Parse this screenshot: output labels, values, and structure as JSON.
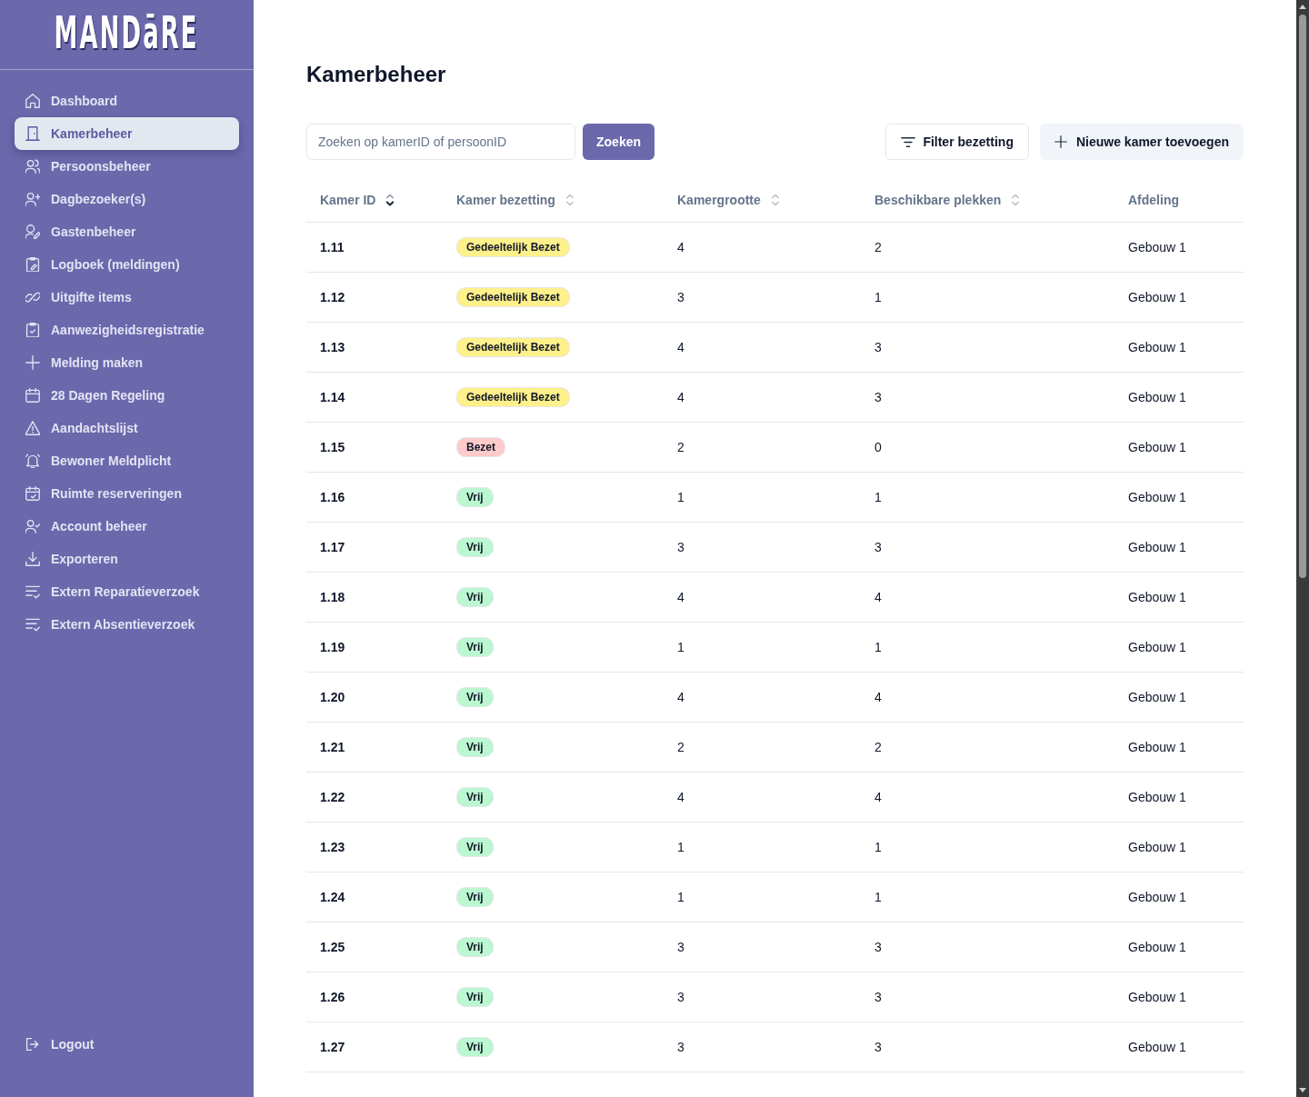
{
  "sidebar": {
    "logo": "MANDāRE",
    "items": [
      {
        "label": "Dashboard",
        "selected": false
      },
      {
        "label": "Kamerbeheer",
        "selected": true
      },
      {
        "label": "Persoonsbeheer",
        "selected": false
      },
      {
        "label": "Dagbezoeker(s)",
        "selected": false
      },
      {
        "label": "Gastenbeheer",
        "selected": false
      },
      {
        "label": "Logboek (meldingen)",
        "selected": false
      },
      {
        "label": "Uitgifte items",
        "selected": false
      },
      {
        "label": "Aanwezigheidsregistratie",
        "selected": false
      },
      {
        "label": "Melding maken",
        "selected": false
      },
      {
        "label": "28 Dagen Regeling",
        "selected": false
      },
      {
        "label": "Aandachtslijst",
        "selected": false
      },
      {
        "label": "Bewoner Meldplicht",
        "selected": false
      },
      {
        "label": "Ruimte reserveringen",
        "selected": false
      },
      {
        "label": "Account beheer",
        "selected": false
      },
      {
        "label": "Exporteren",
        "selected": false
      },
      {
        "label": "Extern Reparatieverzoek",
        "selected": false
      },
      {
        "label": "Extern Absentieverzoek",
        "selected": false
      }
    ],
    "logout": "Logout"
  },
  "page": {
    "title": "Kamerbeheer"
  },
  "toolbar": {
    "search": {
      "placeholder": "Zoeken op kamerID of persoonID"
    },
    "search_button": "Zoeken",
    "filter_button": "Filter bezetting",
    "add_button": "Nieuwe kamer toevoegen"
  },
  "table": {
    "columns": [
      {
        "label": "Kamer ID",
        "sortable": true,
        "sorted": true
      },
      {
        "label": "Kamer bezetting",
        "sortable": true,
        "sorted": false
      },
      {
        "label": "Kamergrootte",
        "sortable": true,
        "sorted": false
      },
      {
        "label": "Beschikbare plekken",
        "sortable": true,
        "sorted": false
      },
      {
        "label": "Afdeling",
        "sortable": false
      }
    ],
    "rows": [
      {
        "kamer_id": "1.11",
        "bezetting": {
          "label": "Gedeeltelijk Bezet",
          "color": "#fef08a"
        },
        "kamergrootte": "4",
        "beschikbare_plekken": "2",
        "afdeling": "Gebouw 1"
      },
      {
        "kamer_id": "1.12",
        "bezetting": {
          "label": "Gedeeltelijk Bezet",
          "color": "#fef08a"
        },
        "kamergrootte": "3",
        "beschikbare_plekken": "1",
        "afdeling": "Gebouw 1"
      },
      {
        "kamer_id": "1.13",
        "bezetting": {
          "label": "Gedeeltelijk Bezet",
          "color": "#fef08a"
        },
        "kamergrootte": "4",
        "beschikbare_plekken": "3",
        "afdeling": "Gebouw 1"
      },
      {
        "kamer_id": "1.14",
        "bezetting": {
          "label": "Gedeeltelijk Bezet",
          "color": "#fef08a"
        },
        "kamergrootte": "4",
        "beschikbare_plekken": "3",
        "afdeling": "Gebouw 1"
      },
      {
        "kamer_id": "1.15",
        "bezetting": {
          "label": "Bezet",
          "color": "#fecaca"
        },
        "kamergrootte": "2",
        "beschikbare_plekken": "0",
        "afdeling": "Gebouw 1"
      },
      {
        "kamer_id": "1.16",
        "bezetting": {
          "label": "Vrij",
          "color": "#bbf7d0"
        },
        "kamergrootte": "1",
        "beschikbare_plekken": "1",
        "afdeling": "Gebouw 1"
      },
      {
        "kamer_id": "1.17",
        "bezetting": {
          "label": "Vrij",
          "color": "#bbf7d0"
        },
        "kamergrootte": "3",
        "beschikbare_plekken": "3",
        "afdeling": "Gebouw 1"
      },
      {
        "kamer_id": "1.18",
        "bezetting": {
          "label": "Vrij",
          "color": "#bbf7d0"
        },
        "kamergrootte": "4",
        "beschikbare_plekken": "4",
        "afdeling": "Gebouw 1"
      },
      {
        "kamer_id": "1.19",
        "bezetting": {
          "label": "Vrij",
          "color": "#bbf7d0"
        },
        "kamergrootte": "1",
        "beschikbare_plekken": "1",
        "afdeling": "Gebouw 1"
      },
      {
        "kamer_id": "1.20",
        "bezetting": {
          "label": "Vrij",
          "color": "#bbf7d0"
        },
        "kamergrootte": "4",
        "beschikbare_plekken": "4",
        "afdeling": "Gebouw 1"
      },
      {
        "kamer_id": "1.21",
        "bezetting": {
          "label": "Vrij",
          "color": "#bbf7d0"
        },
        "kamergrootte": "2",
        "beschikbare_plekken": "2",
        "afdeling": "Gebouw 1"
      },
      {
        "kamer_id": "1.22",
        "bezetting": {
          "label": "Vrij",
          "color": "#bbf7d0"
        },
        "kamergrootte": "4",
        "beschikbare_plekken": "4",
        "afdeling": "Gebouw 1"
      },
      {
        "kamer_id": "1.23",
        "bezetting": {
          "label": "Vrij",
          "color": "#bbf7d0"
        },
        "kamergrootte": "1",
        "beschikbare_plekken": "1",
        "afdeling": "Gebouw 1"
      },
      {
        "kamer_id": "1.24",
        "bezetting": {
          "label": "Vrij",
          "color": "#bbf7d0"
        },
        "kamergrootte": "1",
        "beschikbare_plekken": "1",
        "afdeling": "Gebouw 1"
      },
      {
        "kamer_id": "1.25",
        "bezetting": {
          "label": "Vrij",
          "color": "#bbf7d0"
        },
        "kamergrootte": "3",
        "beschikbare_plekken": "3",
        "afdeling": "Gebouw 1"
      },
      {
        "kamer_id": "1.26",
        "bezetting": {
          "label": "Vrij",
          "color": "#bbf7d0"
        },
        "kamergrootte": "3",
        "beschikbare_plekken": "3",
        "afdeling": "Gebouw 1"
      },
      {
        "kamer_id": "1.27",
        "bezetting": {
          "label": "Vrij",
          "color": "#bbf7d0"
        },
        "kamergrootte": "3",
        "beschikbare_plekken": "3",
        "afdeling": "Gebouw 1"
      }
    ]
  }
}
